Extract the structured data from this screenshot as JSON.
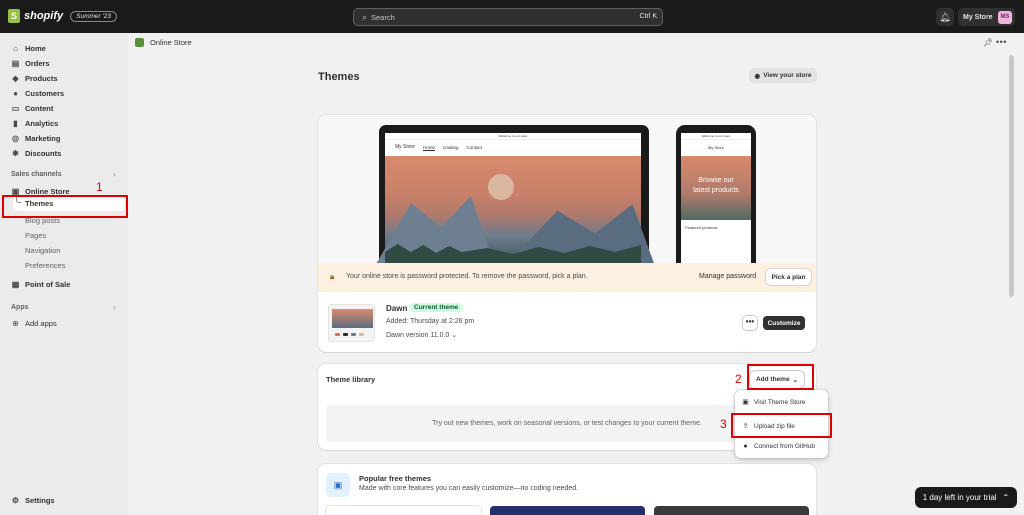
{
  "topbar": {
    "brand": "shopify",
    "edition": "Summer '23",
    "search_placeholder": "Search",
    "search_shortcut": "Ctrl K",
    "store_name": "My Store",
    "avatar_initials": "MS"
  },
  "breadcrumb": {
    "label": "Online Store"
  },
  "sidebar": {
    "items": [
      {
        "label": "Home",
        "icon": "home-icon"
      },
      {
        "label": "Orders",
        "icon": "orders-icon"
      },
      {
        "label": "Products",
        "icon": "tag-icon"
      },
      {
        "label": "Customers",
        "icon": "person-icon"
      },
      {
        "label": "Content",
        "icon": "content-icon"
      },
      {
        "label": "Analytics",
        "icon": "bar-chart-icon"
      },
      {
        "label": "Marketing",
        "icon": "target-icon"
      },
      {
        "label": "Discounts",
        "icon": "discount-icon"
      }
    ],
    "sales_channels_label": "Sales channels",
    "online_store_label": "Online Store",
    "online_store_sub": [
      "Themes",
      "Blog posts",
      "Pages",
      "Navigation",
      "Preferences"
    ],
    "point_of_sale_label": "Point of Sale",
    "apps_label": "Apps",
    "add_apps_label": "Add apps",
    "settings_label": "Settings"
  },
  "annotations": {
    "step1": "1",
    "step2": "2",
    "step3": "3"
  },
  "page": {
    "title": "Themes",
    "view_store_label": "View your store"
  },
  "preview": {
    "announcement": "Welcome to our store",
    "laptop_store_name": "My Store",
    "laptop_nav": [
      "Home",
      "Catalog",
      "Contact"
    ],
    "phone_store_name": "My Store",
    "phone_headline_1": "Browse our",
    "phone_headline_2": "latest products",
    "phone_featured": "Featured products"
  },
  "password_notice": {
    "text": "Your online store is password protected. To remove the password, pick a plan.",
    "manage_label": "Manage password",
    "pick_plan_label": "Pick a plan"
  },
  "current_theme": {
    "name": "Dawn",
    "badge": "Current theme",
    "added": "Added: Thursday at 2:26 pm",
    "version": "Dawn version 11.0.0",
    "more_label": "•••",
    "customize_label": "Customize"
  },
  "theme_library": {
    "title": "Theme library",
    "add_theme_label": "Add theme",
    "empty_text": "Try out new themes, work on seasonal versions, or test changes to your current theme.",
    "menu": [
      "Visit Theme Store",
      "Upload zip file",
      "Connect from GitHub"
    ]
  },
  "popular_free": {
    "title": "Popular free themes",
    "subtitle": "Made with core features you can easily customize—no coding needed."
  },
  "trial": {
    "label": "1 day left in your trial"
  }
}
